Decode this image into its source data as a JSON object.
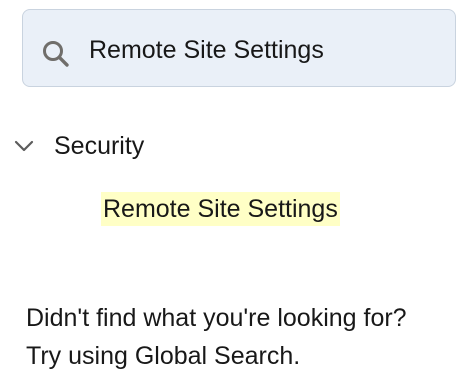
{
  "search": {
    "value": "Remote Site Settings",
    "icon": "search-icon"
  },
  "section": {
    "label": "Security",
    "expanded": true,
    "icon": "chevron-down-icon"
  },
  "results": [
    {
      "label": "Remote Site Settings",
      "highlight_color": "#ffffc6"
    }
  ],
  "not_found": {
    "line1": "Didn't find what you're looking for?",
    "line2": "Try using Global Search."
  },
  "colors": {
    "search_bg": "#eaf0f8",
    "search_border": "#c9d3df",
    "highlight": "#ffffc6",
    "text": "#181818",
    "icon": "#706e6b"
  }
}
